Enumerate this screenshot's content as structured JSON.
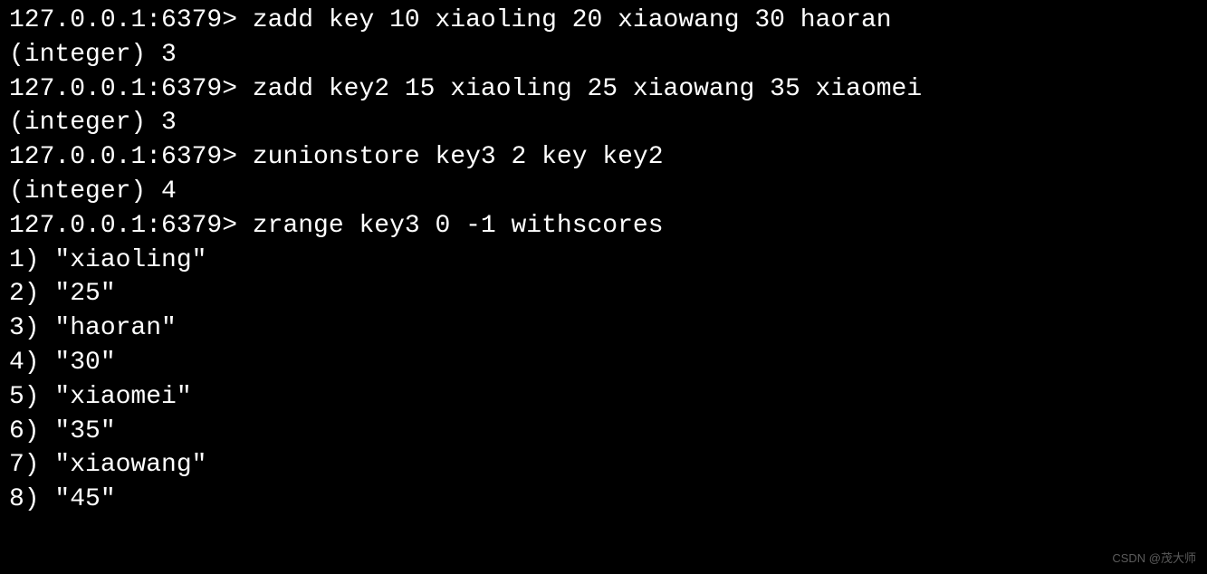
{
  "terminal": {
    "prompt": "127.0.0.1:6379> ",
    "lines": [
      {
        "type": "cmd",
        "command": "zadd key 10 xiaoling 20 xiaowang 30 haoran"
      },
      {
        "type": "out",
        "text": "(integer) 3"
      },
      {
        "type": "cmd",
        "command": "zadd key2 15 xiaoling 25 xiaowang 35 xiaomei"
      },
      {
        "type": "out",
        "text": "(integer) 3"
      },
      {
        "type": "cmd",
        "command": "zunionstore key3 2 key key2"
      },
      {
        "type": "out",
        "text": "(integer) 4"
      },
      {
        "type": "cmd",
        "command": "zrange key3 0 -1 withscores"
      },
      {
        "type": "out",
        "text": "1) \"xiaoling\""
      },
      {
        "type": "out",
        "text": "2) \"25\""
      },
      {
        "type": "out",
        "text": "3) \"haoran\""
      },
      {
        "type": "out",
        "text": "4) \"30\""
      },
      {
        "type": "out",
        "text": "5) \"xiaomei\""
      },
      {
        "type": "out",
        "text": "6) \"35\""
      },
      {
        "type": "out",
        "text": "7) \"xiaowang\""
      },
      {
        "type": "out",
        "text": "8) \"45\""
      }
    ]
  },
  "watermark": "CSDN @茂大师"
}
